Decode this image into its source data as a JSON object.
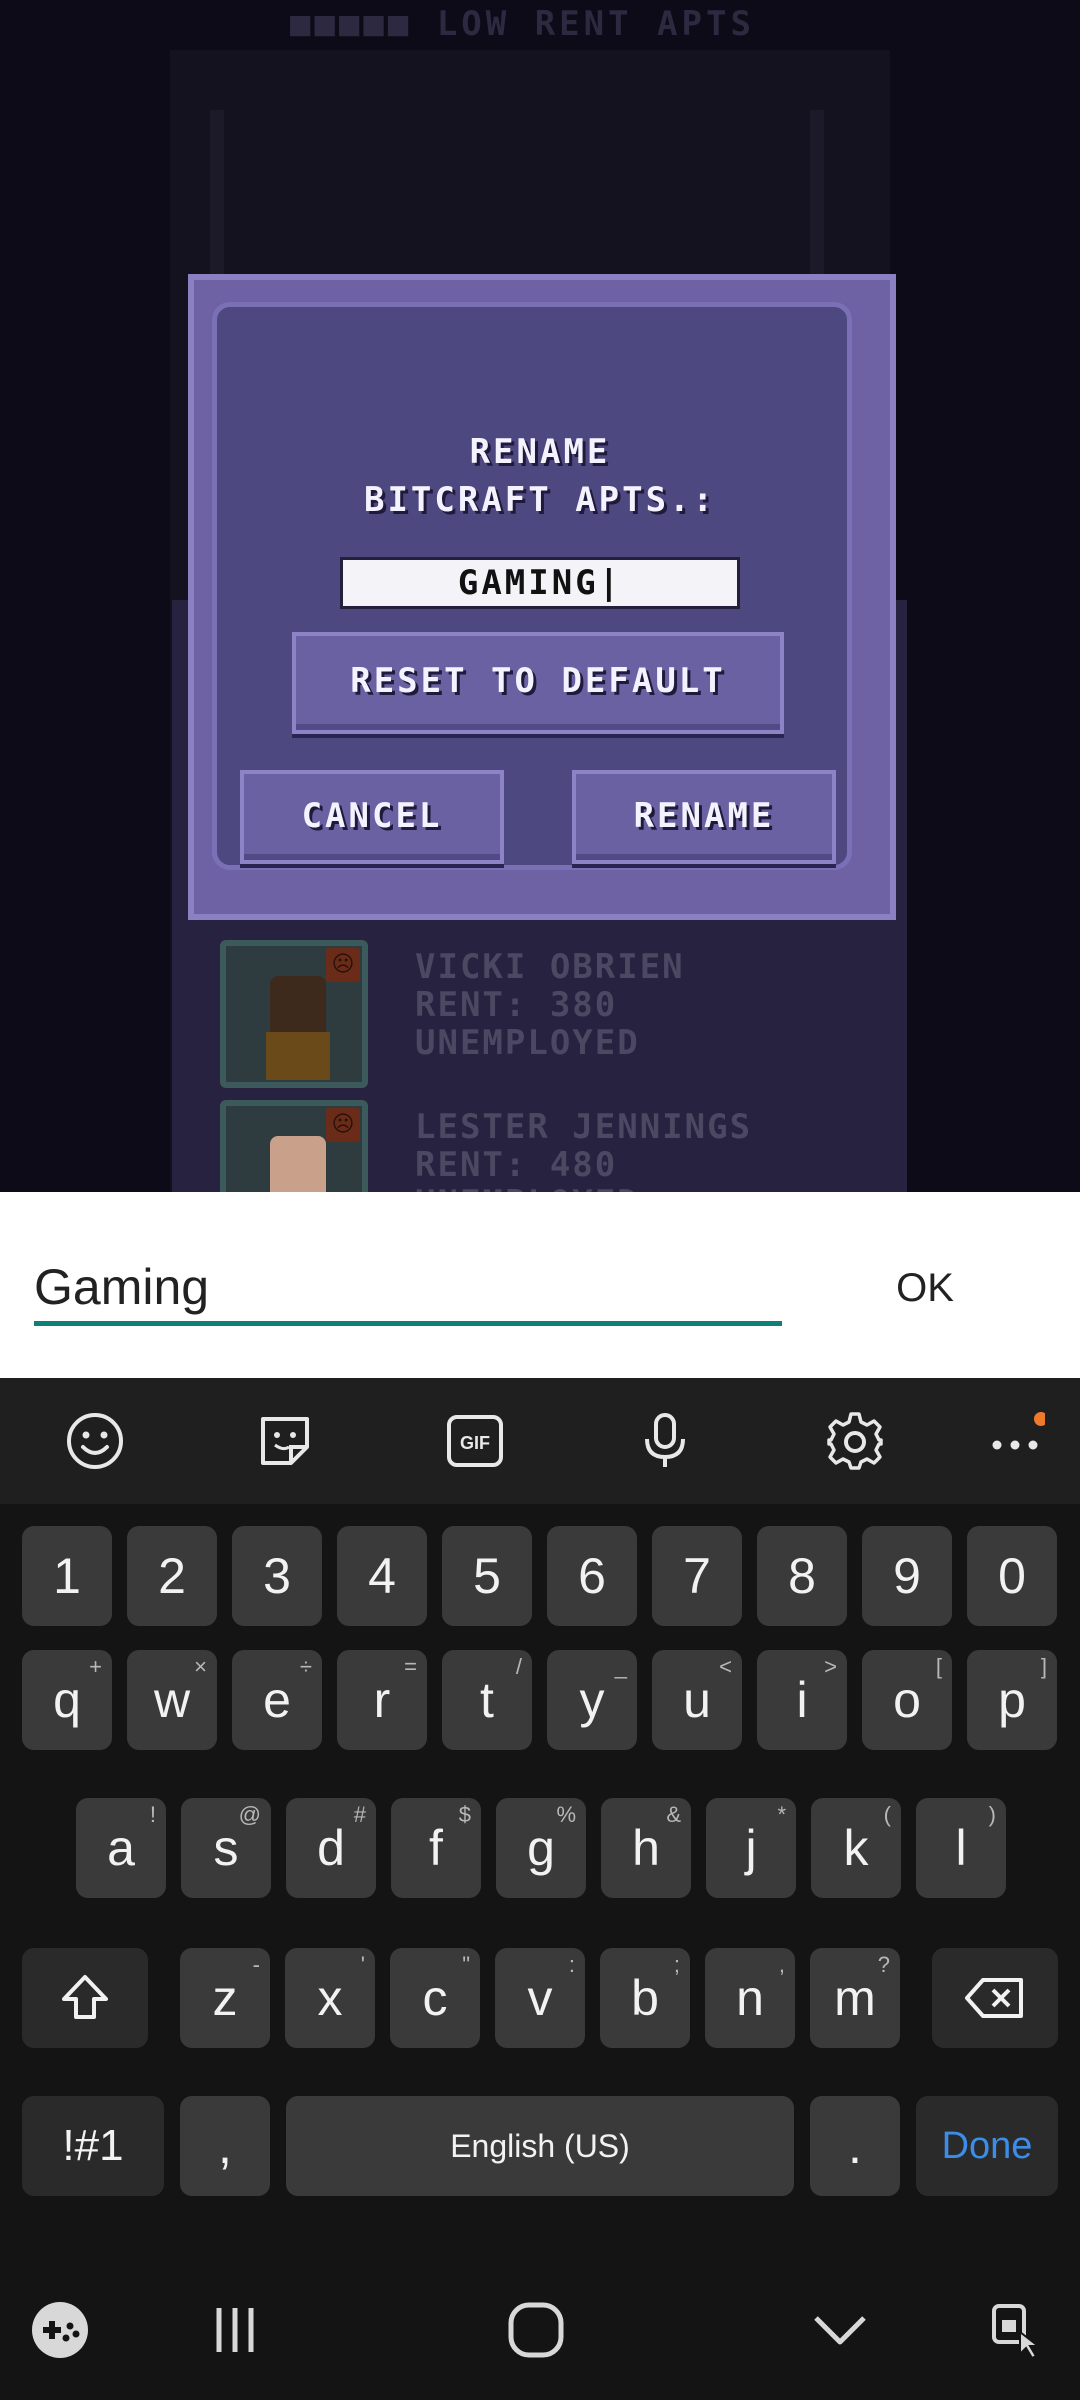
{
  "game": {
    "floor_title": "■■■■■ LOW RENT APTS",
    "tenants": [
      {
        "name": "VICKI OBRIEN",
        "rent": "RENT: 380",
        "job": "UNEMPLOYED"
      },
      {
        "name": "LESTER JENNINGS",
        "rent": "RENT: 480",
        "job": "UNEMPLOYED"
      }
    ]
  },
  "dialog": {
    "title_line1": "RENAME",
    "title_line2": "BITCRAFT APTS.:",
    "name_value": "GAMING|",
    "reset_label": "RESET TO DEFAULT",
    "cancel_label": "CANCEL",
    "rename_label": "RENAME"
  },
  "input_bar": {
    "value": "Gaming",
    "ok_label": "OK"
  },
  "keyboard": {
    "toolbar_icons": [
      "emoji-icon",
      "sticker-icon",
      "gif-icon",
      "microphone-icon",
      "settings-icon",
      "more-icon"
    ],
    "gif_label": "GIF",
    "number_row": [
      "1",
      "2",
      "3",
      "4",
      "5",
      "6",
      "7",
      "8",
      "9",
      "0"
    ],
    "row1": [
      {
        "k": "q",
        "h": "+"
      },
      {
        "k": "w",
        "h": "×"
      },
      {
        "k": "e",
        "h": "÷"
      },
      {
        "k": "r",
        "h": "="
      },
      {
        "k": "t",
        "h": "/"
      },
      {
        "k": "y",
        "h": "_"
      },
      {
        "k": "u",
        "h": "<"
      },
      {
        "k": "i",
        "h": ">"
      },
      {
        "k": "o",
        "h": "["
      },
      {
        "k": "p",
        "h": "]"
      }
    ],
    "row2": [
      {
        "k": "a",
        "h": "!"
      },
      {
        "k": "s",
        "h": "@"
      },
      {
        "k": "d",
        "h": "#"
      },
      {
        "k": "f",
        "h": "$"
      },
      {
        "k": "g",
        "h": "%"
      },
      {
        "k": "h",
        "h": "&"
      },
      {
        "k": "j",
        "h": "*"
      },
      {
        "k": "k",
        "h": "("
      },
      {
        "k": "l",
        "h": ")"
      }
    ],
    "row3": [
      {
        "k": "z",
        "h": "-"
      },
      {
        "k": "x",
        "h": "'"
      },
      {
        "k": "c",
        "h": "\""
      },
      {
        "k": "v",
        "h": ":"
      },
      {
        "k": "b",
        "h": ";"
      },
      {
        "k": "n",
        "h": ","
      },
      {
        "k": "m",
        "h": "?"
      }
    ],
    "symbols_label": "!#1",
    "comma_label": ",",
    "space_label": "English (US)",
    "period_label": ".",
    "done_label": "Done",
    "accent_color": "#3b8de8",
    "notification_dot_color": "#f07a2c"
  },
  "navbar": {
    "icons": [
      "game-tools-icon",
      "recent-apps-icon",
      "home-icon",
      "hide-keyboard-icon",
      "accessibility-icon"
    ]
  }
}
